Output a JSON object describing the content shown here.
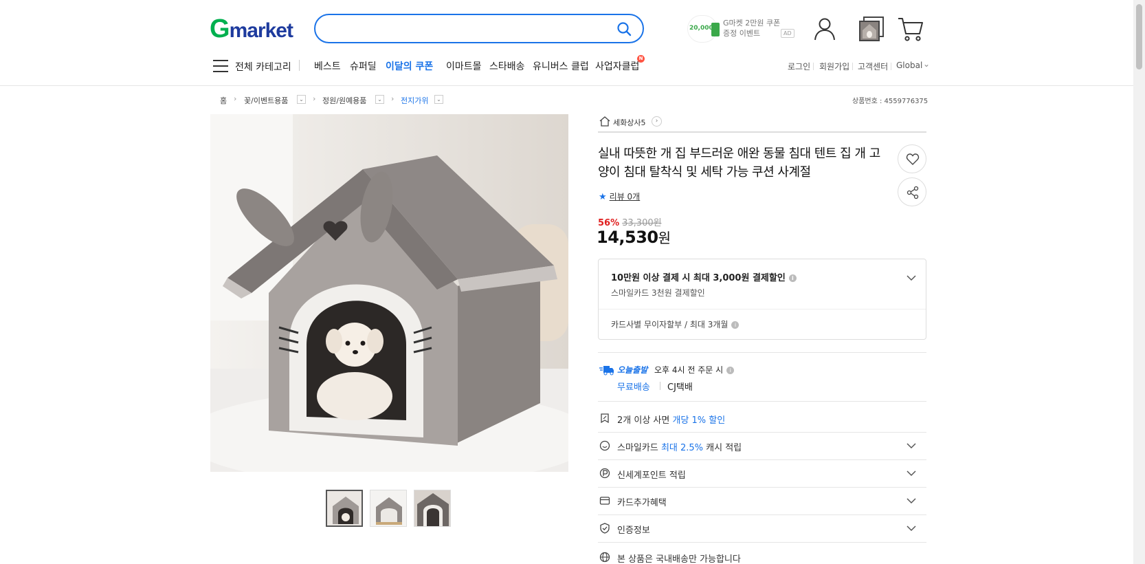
{
  "header": {
    "logo_g": "G",
    "logo_rest": "market",
    "search_placeholder": "",
    "ad_amount": "20,000",
    "ad_line1": "G마켓 2만원 쿠폰",
    "ad_line2": "증정 이벤트",
    "ad_badge": "AD"
  },
  "nav": {
    "all_category": "전체 카테고리",
    "items": [
      {
        "label": "베스트"
      },
      {
        "label": "슈퍼딜"
      },
      {
        "label": "이달의 쿠폰"
      },
      {
        "label": "이마트몰"
      },
      {
        "label": "스타배송"
      },
      {
        "label": "유니버스 클럽"
      },
      {
        "label": "사업자클럽"
      }
    ],
    "new_badge": "N",
    "utils": [
      "로그인",
      "회원가입",
      "고객센터",
      "Global"
    ]
  },
  "breadcrumb": {
    "items": [
      "홈",
      "꽃/이벤트용품",
      "정원/원예용품",
      "전지가위"
    ],
    "product_no_label": "상품번호 : 4559776375"
  },
  "product": {
    "seller": "세화상사5",
    "title": "실내 따뜻한 개 집 부드러운 애완 동물 침대 텐트 집 개 고양이 침대 탈착식 및 세탁 가능 쿠션 사계절",
    "review_label": "리뷰 0개",
    "discount_rate": "56%",
    "original_price": "33,300원",
    "price": "14,530",
    "price_unit": "원",
    "discount_box": {
      "main": "10만원 이상 결제 시 최대 3,000원 결제할인",
      "sub": "스마일카드 3천원 결제할인",
      "installment": "카드사별 무이자할부 / 최대 3개월"
    },
    "shipping": {
      "today": "오늘출발",
      "cutoff": "오후 4시 전 주문 시",
      "free": "무료배송",
      "courier": "CJ택배"
    },
    "benefits": [
      {
        "pre": "2개 이상 사면 ",
        "blue": "개당 1% 할인",
        "post": "",
        "icon": "discount-tag-icon",
        "chevron": false
      },
      {
        "pre": "스마일카드 ",
        "blue": "최대 2.5%",
        "post": " 캐시 적립",
        "icon": "smile-card-icon",
        "chevron": true
      },
      {
        "pre": "신세계포인트 적립",
        "blue": "",
        "post": "",
        "icon": "point-icon",
        "chevron": true
      },
      {
        "pre": "카드추가혜택",
        "blue": "",
        "post": "",
        "icon": "card-icon",
        "chevron": true
      },
      {
        "pre": "인증정보",
        "blue": "",
        "post": "",
        "icon": "shield-check-icon",
        "chevron": true
      },
      {
        "pre": "본 상품은 국내배송만 가능합니다",
        "blue": "",
        "post": "",
        "icon": "globe-icon",
        "chevron": false
      }
    ]
  },
  "colors": {
    "accent_blue": "#1a73e8",
    "sale_red": "#e02020",
    "logo_green": "#00b04f",
    "logo_navy": "#1e3b9e"
  }
}
